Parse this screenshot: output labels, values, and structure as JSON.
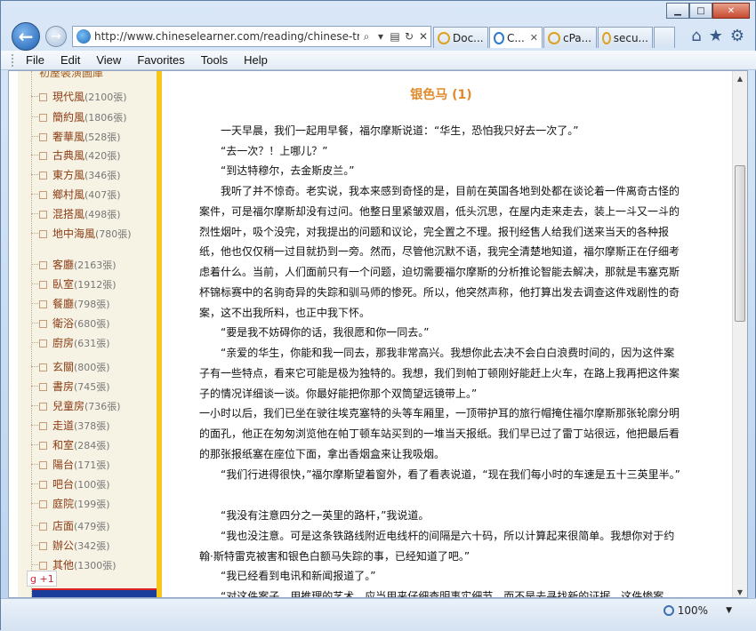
{
  "window": {
    "minimize": "▁",
    "maximize": "□",
    "close": "✕"
  },
  "address": {
    "url": "http://www.chineselearner.com/reading/chinese-trans",
    "search_icon": "⌕",
    "dropdown": "▾",
    "refresh": "↻",
    "stop": "✕"
  },
  "tabs": [
    {
      "label": "Doc...",
      "close": ""
    },
    {
      "label": "C...",
      "close": "✕"
    },
    {
      "label": "cPa...",
      "close": ""
    },
    {
      "label": "secu...",
      "close": ""
    }
  ],
  "toolbar_icons": {
    "home": "⌂",
    "favorites": "★",
    "tools": "⚙"
  },
  "menu": [
    "File",
    "Edit",
    "View",
    "Favorites",
    "Tools",
    "Help"
  ],
  "sidebar": {
    "top_title": "初屋裝潢圖庫",
    "items": [
      {
        "name": "現代風",
        "count": "(2100張)"
      },
      {
        "name": "簡約風",
        "count": "(1806張)"
      },
      {
        "name": "奢華風",
        "count": "(528張)"
      },
      {
        "name": "古典風",
        "count": "(420張)"
      },
      {
        "name": "東方風",
        "count": "(346張)"
      },
      {
        "name": "鄉村風",
        "count": "(407張)"
      },
      {
        "name": "混搭風",
        "count": "(498張)"
      },
      {
        "name": "地中海風",
        "count": "(780張)"
      },
      {
        "name": "客廳",
        "count": "(2163張)"
      },
      {
        "name": "臥室",
        "count": "(1912張)"
      },
      {
        "name": "餐廳",
        "count": "(798張)"
      },
      {
        "name": "衛浴",
        "count": "(680張)"
      },
      {
        "name": "廚房",
        "count": "(631張)"
      },
      {
        "name": "玄關",
        "count": "(800張)"
      },
      {
        "name": "書房",
        "count": "(745張)"
      },
      {
        "name": "兒童房",
        "count": "(736張)"
      },
      {
        "name": "走道",
        "count": "(378張)"
      },
      {
        "name": "和室",
        "count": "(284張)"
      },
      {
        "name": "陽台",
        "count": "(171張)"
      },
      {
        "name": "吧台",
        "count": "(100張)"
      },
      {
        "name": "庭院",
        "count": "(199張)"
      },
      {
        "name": "店面",
        "count": "(479張)"
      },
      {
        "name": "辦公",
        "count": "(342張)"
      },
      {
        "name": "其他",
        "count": "(1300張)"
      }
    ],
    "gplus": "g +1"
  },
  "article": {
    "title": "银色马 (1)",
    "paragraphs": [
      "　　一天早晨，我们一起用早餐，福尔摩斯说道：“华生，恐怕我只好去一次了。”",
      "　　“去一次？！上哪儿？”",
      "　　“到达特穆尔，去金斯皮兰。”",
      "　　我听了并不惊奇。老实说，我本来感到奇怪的是，目前在英国各地到处都在谈论着一件离奇古怪的案件，可是福尔摩斯却没有过问。他整日里紧皱双眉，低头沉思，在屋内走来走去，装上一斗又一斗的烈性烟叶，吸个没完，对我提出的问题和议论，完全置之不理。报刊经售人给我们送来当天的各种报纸，他也仅仅稍一过目就扔到一旁。然而，尽管他沉默不语，我完全清楚地知道，福尔摩斯正在仔细考虑着什么。当前，人们面前只有一个问题，迫切需要福尔摩斯的分析推论智能去解决，那就是韦塞克斯杯锦标赛中的名驹奇异的失踪和驯马师的惨死。所以，他突然声称，他打算出发去调查这件戏剧性的奇案，这不出我所料，也正中我下怀。",
      "　　“要是我不妨碍你的话，我很愿和你一同去。”",
      "　　“亲爱的华生，你能和我一同去，那我非常高兴。我想你此去决不会白白浪费时间的，因为这件案子有一些特点，看来它可能是极为独特的。我想，我们到帕丁顿刚好能赶上火车，在路上我再把这件案子的情况详细谈一谈。你最好能把你那个双筒望远镜带上。”",
      "一小时以后，我们已坐在驶往埃克塞特的头等车厢里，一顶带护耳的旅行帽掩住福尔摩斯那张轮廓分明的面孔，他正在匆匆浏览他在帕丁顿车站买到的一堆当天报纸。我们早已过了雷丁站很远，他把最后看的那张报纸塞在座位下面，拿出香烟盒来让我吸烟。",
      "　　“我们行进得很快，”福尔摩斯望着窗外，看了看表说道，“现在我们每小时的车速是五十三英里半。”",
      "　　“我没有注意四分之一英里的路杆，”我说道。",
      "　　“我也没注意。可是这条铁路线附近电线杆的间隔是六十码，所以计算起来很简单。我想你对于约翰·斯特雷克被害和银色白额马失踪的事，已经知道了吧。”",
      "　　“我已经看到电讯和新闻报道了。”",
      "　　“对这件案子，用推理的艺术，应当用来仔细查明事实细节，而不是去寻找新的证据。这件惨案"
    ]
  },
  "scroll": {
    "up": "▲",
    "down": "▼"
  },
  "status": {
    "zoom": "100%",
    "zoom_arrow": "▼"
  }
}
